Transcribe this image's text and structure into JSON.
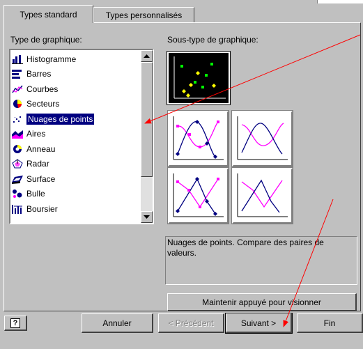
{
  "tabs": [
    {
      "label": "Types standard",
      "active": true
    },
    {
      "label": "Types personnalisés",
      "active": false
    }
  ],
  "chart_type_label": "Type de graphique:",
  "subtype_label": "Sous-type de graphique:",
  "chart_types": [
    {
      "label": "Histogramme",
      "icon": "histogram-icon"
    },
    {
      "label": "Barres",
      "icon": "bar-chart-icon"
    },
    {
      "label": "Courbes",
      "icon": "line-chart-icon"
    },
    {
      "label": "Secteurs",
      "icon": "pie-chart-icon"
    },
    {
      "label": "Nuages de points",
      "icon": "scatter-chart-icon",
      "selected": true
    },
    {
      "label": "Aires",
      "icon": "area-chart-icon"
    },
    {
      "label": "Anneau",
      "icon": "doughnut-chart-icon"
    },
    {
      "label": "Radar",
      "icon": "radar-chart-icon"
    },
    {
      "label": "Surface",
      "icon": "surface-chart-icon"
    },
    {
      "label": "Bulle",
      "icon": "bubble-chart-icon"
    },
    {
      "label": "Boursier",
      "icon": "stock-chart-icon"
    }
  ],
  "description": "Nuages de points. Compare des paires de valeurs.",
  "buttons": {
    "preview": "Maintenir appuyé pour visionner",
    "help": "?",
    "cancel": "Annuler",
    "previous": "< Précédent",
    "next": "Suivant >",
    "finish": "Fin"
  },
  "colors": {
    "selection": "#000080",
    "annotation_arrow": "#ff0000",
    "series_magenta": "#ff00ff",
    "series_navy": "#000080",
    "point_green": "#00ff00",
    "point_yellow": "#ffff00"
  }
}
